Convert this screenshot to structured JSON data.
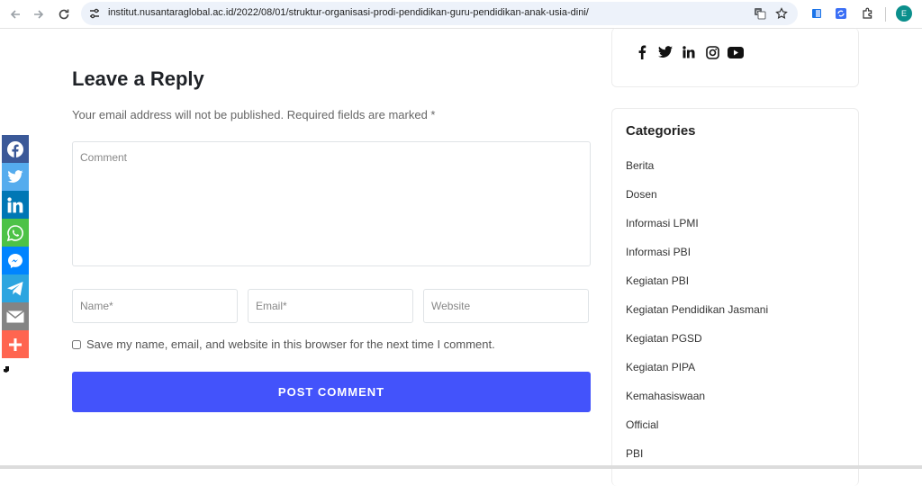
{
  "browser": {
    "url": "institut.nusantaraglobal.ac.id/2022/08/01/struktur-organisasi-prodi-pendidikan-guru-pendidikan-anak-usia-dini/",
    "profile_initial": "E"
  },
  "reply": {
    "title": "Leave a Reply",
    "notes": "Your email address will not be published. Required fields are marked *",
    "comment_placeholder": "Comment",
    "name_placeholder": "Name*",
    "email_placeholder": "Email*",
    "website_placeholder": "Website",
    "cookie_label": "Save my name, email, and website in this browser for the next time I comment.",
    "submit_label": "POST COMMENT"
  },
  "sidebar": {
    "social_icons": [
      "facebook-icon",
      "twitter-icon",
      "linkedin-icon",
      "instagram-icon",
      "youtube-icon"
    ],
    "categories_title": "Categories",
    "categories": [
      "Berita",
      "Dosen",
      "Informasi LPMI",
      "Informasi PBI",
      "Kegiatan PBI",
      "Kegiatan Pendidikan Jasmani",
      "Kegiatan PGSD",
      "Kegiatan PIPA",
      "Kemahasiswaan",
      "Official",
      "PBI"
    ]
  },
  "share_bar": {
    "buttons": [
      "facebook",
      "twitter",
      "linkedin",
      "whatsapp",
      "messenger",
      "telegram",
      "email",
      "more"
    ],
    "colors": {
      "facebook": "#3b5998",
      "twitter": "#55acee",
      "linkedin": "#0077b5",
      "whatsapp": "#4dc247",
      "messenger": "#0084ff",
      "telegram": "#2ca5e0",
      "email": "#848484",
      "more": "#ff6550"
    }
  },
  "colors": {
    "accent": "#4353fb"
  }
}
